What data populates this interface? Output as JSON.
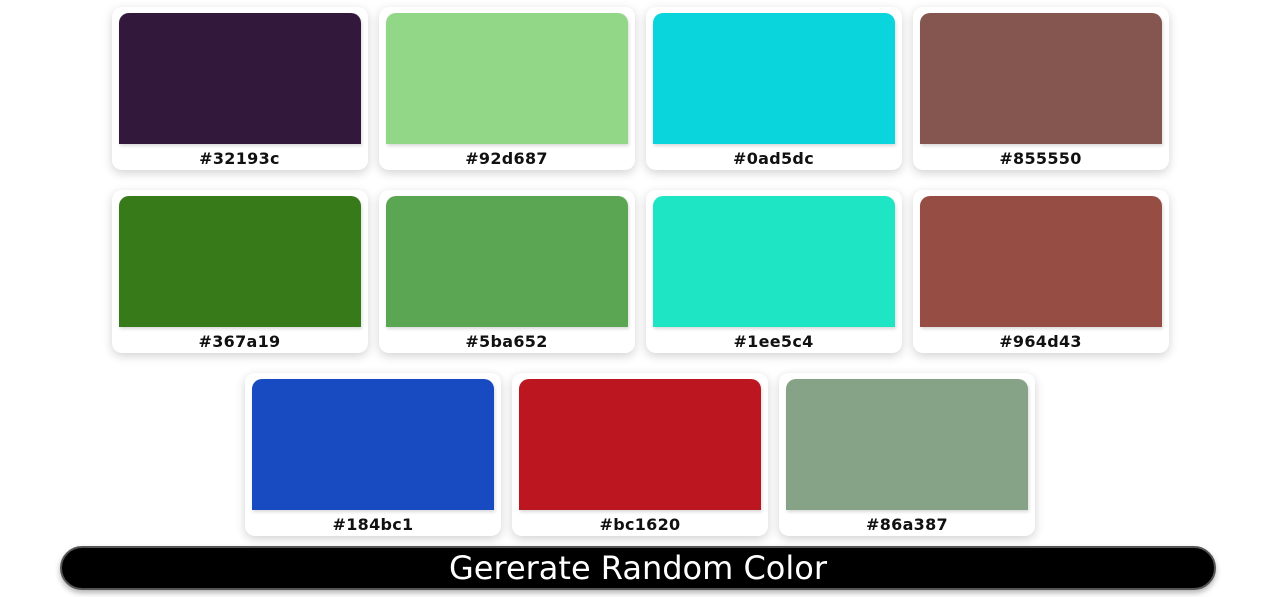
{
  "palette": {
    "colors": [
      {
        "hex": "#32193c"
      },
      {
        "hex": "#92d687"
      },
      {
        "hex": "#0ad5dc"
      },
      {
        "hex": "#855550"
      },
      {
        "hex": "#367a19"
      },
      {
        "hex": "#5ba652"
      },
      {
        "hex": "#1ee5c4"
      },
      {
        "hex": "#964d43"
      },
      {
        "hex": "#184bc1"
      },
      {
        "hex": "#bc1620"
      },
      {
        "hex": "#86a387"
      }
    ]
  },
  "generate_button": {
    "label": "Gererate Random Color"
  }
}
